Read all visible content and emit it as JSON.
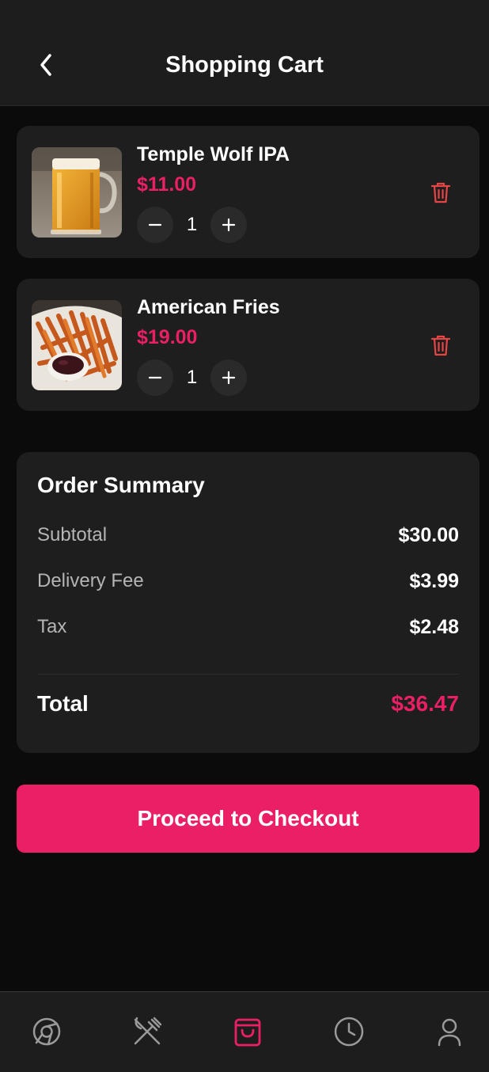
{
  "header": {
    "title": "Shopping Cart"
  },
  "cart": {
    "items": [
      {
        "name": "Temple Wolf IPA",
        "price": "$11.00",
        "quantity": "1"
      },
      {
        "name": "American Fries",
        "price": "$19.00",
        "quantity": "1"
      }
    ]
  },
  "summary": {
    "title": "Order Summary",
    "rows": [
      {
        "label": "Subtotal",
        "value": "$30.00"
      },
      {
        "label": "Delivery Fee",
        "value": "$3.99"
      },
      {
        "label": "Tax",
        "value": "$2.48"
      }
    ],
    "total_label": "Total",
    "total_value": "$36.47"
  },
  "checkout": {
    "label": "Proceed to Checkout"
  },
  "colors": {
    "accent": "#ea1f65",
    "card": "#1e1e1e",
    "background": "#0b0b0b",
    "delete": "#e64545"
  },
  "bottom_nav": {
    "items": [
      {
        "icon": "home-icon",
        "label": ""
      },
      {
        "icon": "menu-icon",
        "label": ""
      },
      {
        "icon": "cart-bag-icon",
        "label": "",
        "active": true
      },
      {
        "icon": "orders-clock-icon",
        "label": ""
      },
      {
        "icon": "profile-icon",
        "label": ""
      }
    ]
  }
}
